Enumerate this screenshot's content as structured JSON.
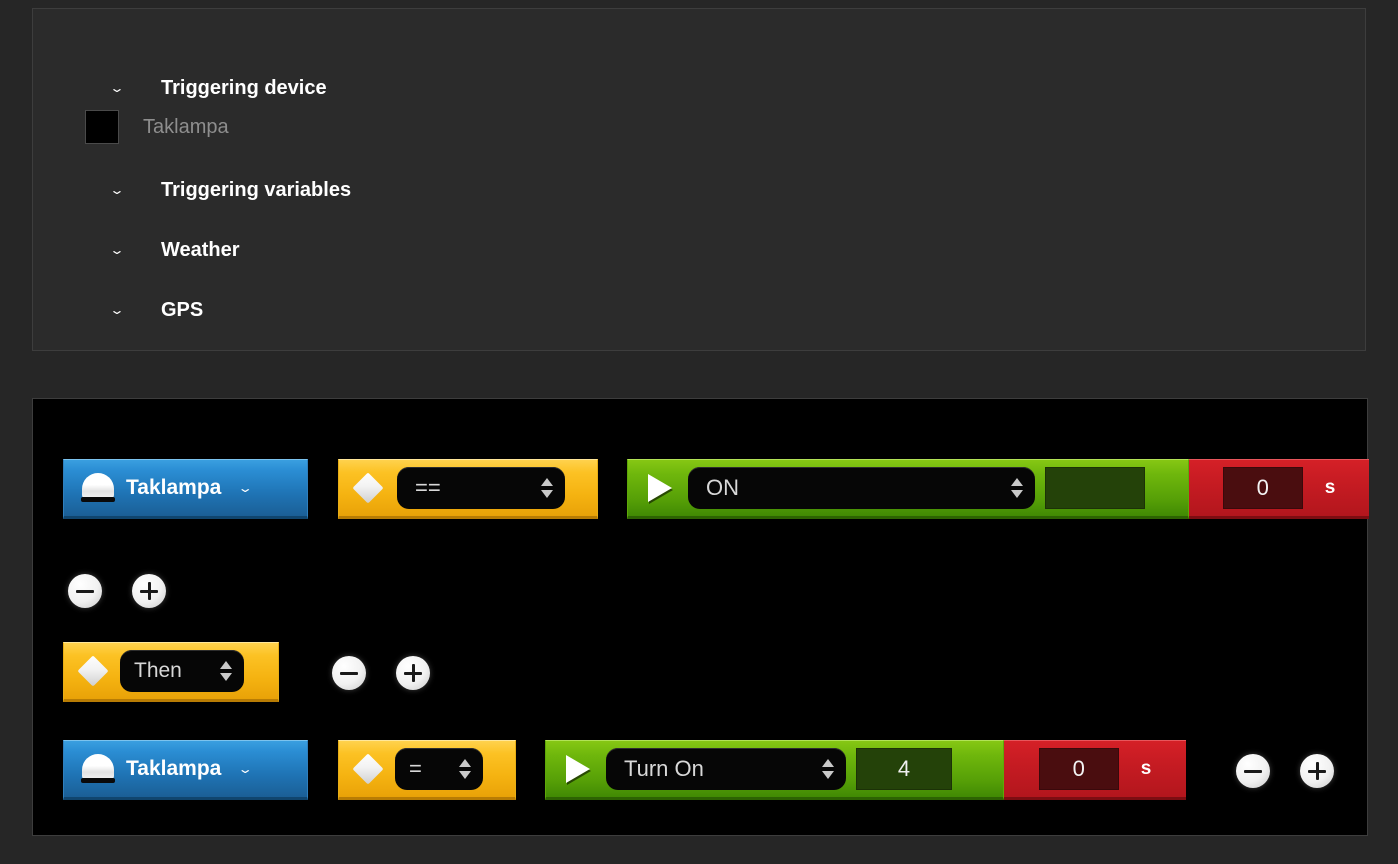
{
  "trigger_panel": {
    "sections": [
      {
        "label": "Triggering device",
        "icon": "chevron-down-icon",
        "expanded": true
      },
      {
        "label": "Triggering variables",
        "icon": "chevron-down-icon",
        "expanded": false
      },
      {
        "label": "Weather",
        "icon": "chevron-down-icon",
        "expanded": false
      },
      {
        "label": "GPS",
        "icon": "chevron-down-icon",
        "expanded": false
      }
    ],
    "device": {
      "swatch_color": "#000000",
      "name": "Taklampa"
    }
  },
  "rule_panel": {
    "rows": [
      {
        "device": {
          "label": "Taklampa",
          "icon": "lamp-icon",
          "chevron": "⌄",
          "color": "#1f74b5"
        },
        "condition": {
          "operator": "==",
          "icon": "diamond-icon",
          "color": "#f5b311"
        },
        "action": {
          "value": "ON",
          "icon": "play-icon",
          "extra_value": "",
          "color": "#6fb70c"
        },
        "delay": {
          "value": "0",
          "unit": "s",
          "color": "#c81c23"
        }
      },
      {
        "device": {
          "label": "Taklampa",
          "icon": "lamp-icon",
          "chevron": "⌄",
          "color": "#1f74b5"
        },
        "condition": {
          "operator": "=",
          "icon": "diamond-icon",
          "color": "#f5b311"
        },
        "action": {
          "value": "Turn On",
          "icon": "play-icon",
          "extra_value": "4",
          "color": "#6fb70c"
        },
        "delay": {
          "value": "0",
          "unit": "s",
          "color": "#c81c23"
        }
      }
    ],
    "connector": {
      "operator": "Then",
      "icon": "diamond-icon",
      "color": "#f5b311"
    },
    "buttons": {
      "remove_label": "−",
      "add_label": "+",
      "remove_name": "minus-button",
      "add_name": "plus-button"
    }
  }
}
